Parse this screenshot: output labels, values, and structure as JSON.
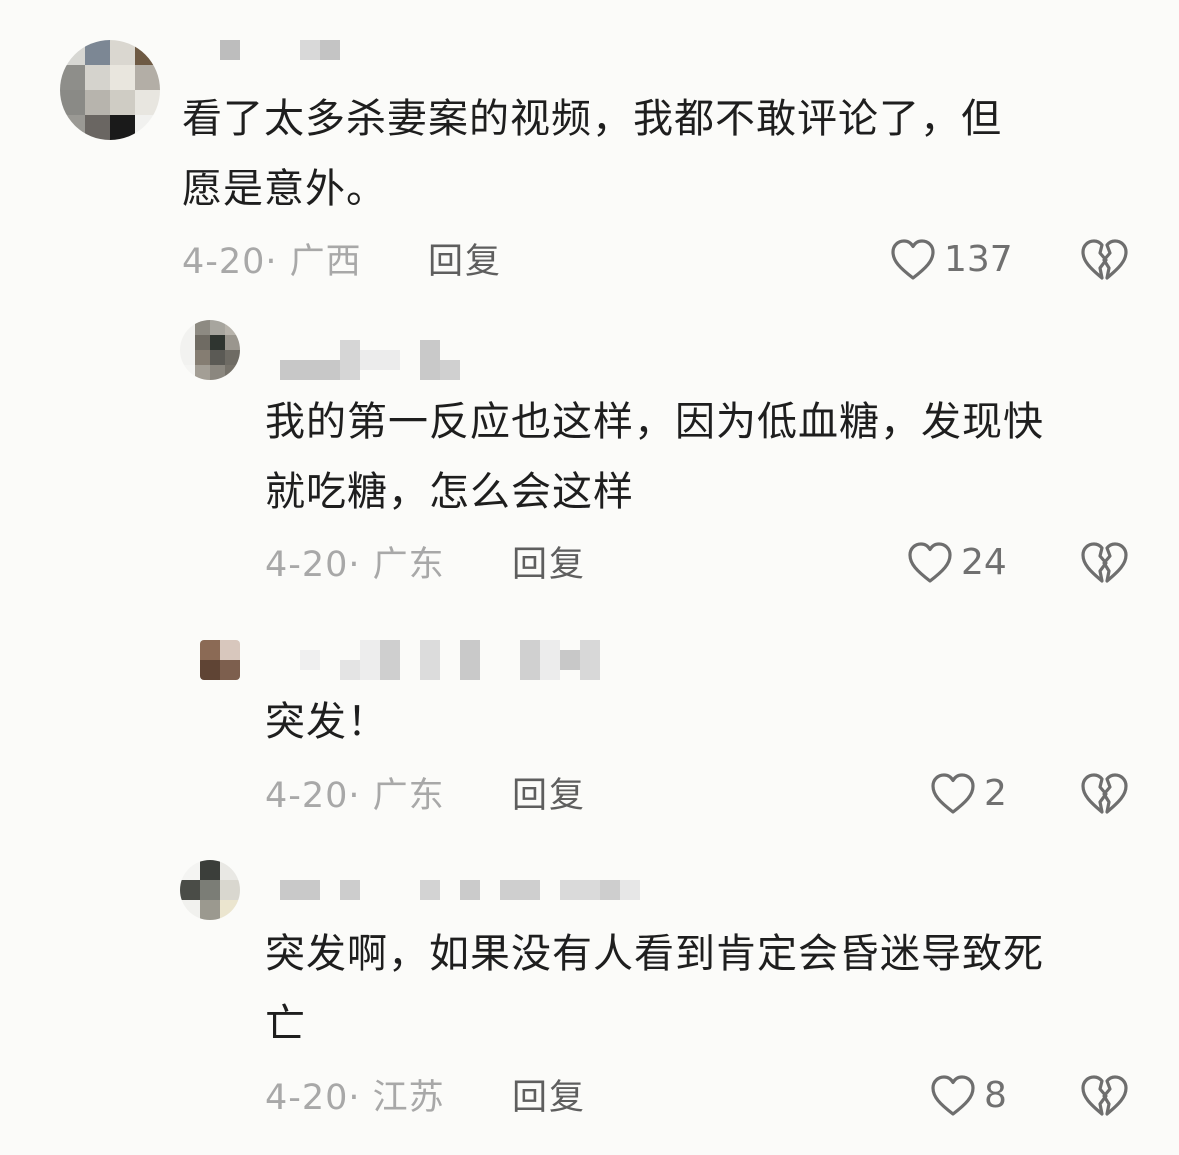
{
  "comments": [
    {
      "text": "看了太多杀妻案的视频，我都不敢评论了，但\n愿是意外。",
      "date_location": "4-20· 广西",
      "reply_label": "回复",
      "likes": "137",
      "level": "top"
    },
    {
      "text": "我的第一反应也这样，因为低血糖，发现快\n就吃糖，怎么会这样",
      "date_location": "4-20· 广东",
      "reply_label": "回复",
      "likes": "24",
      "level": "reply"
    },
    {
      "text": "突发！",
      "date_location": "4-20· 广东",
      "reply_label": "回复",
      "likes": "2",
      "level": "reply"
    },
    {
      "text": "突发啊，如果没有人看到肯定会昏迷导致死\n亡",
      "date_location": "4-20· 江苏",
      "reply_label": "回复",
      "likes": "8",
      "level": "reply"
    }
  ],
  "icons": {
    "like": "heart-outline-icon",
    "dislike": "broken-heart-icon"
  },
  "colors": {
    "text": "#1e1e1e",
    "meta": "#a8a8a8",
    "reply": "#5e5e5e",
    "icon": "#6e6e6e",
    "background": "#fbfbf9"
  }
}
